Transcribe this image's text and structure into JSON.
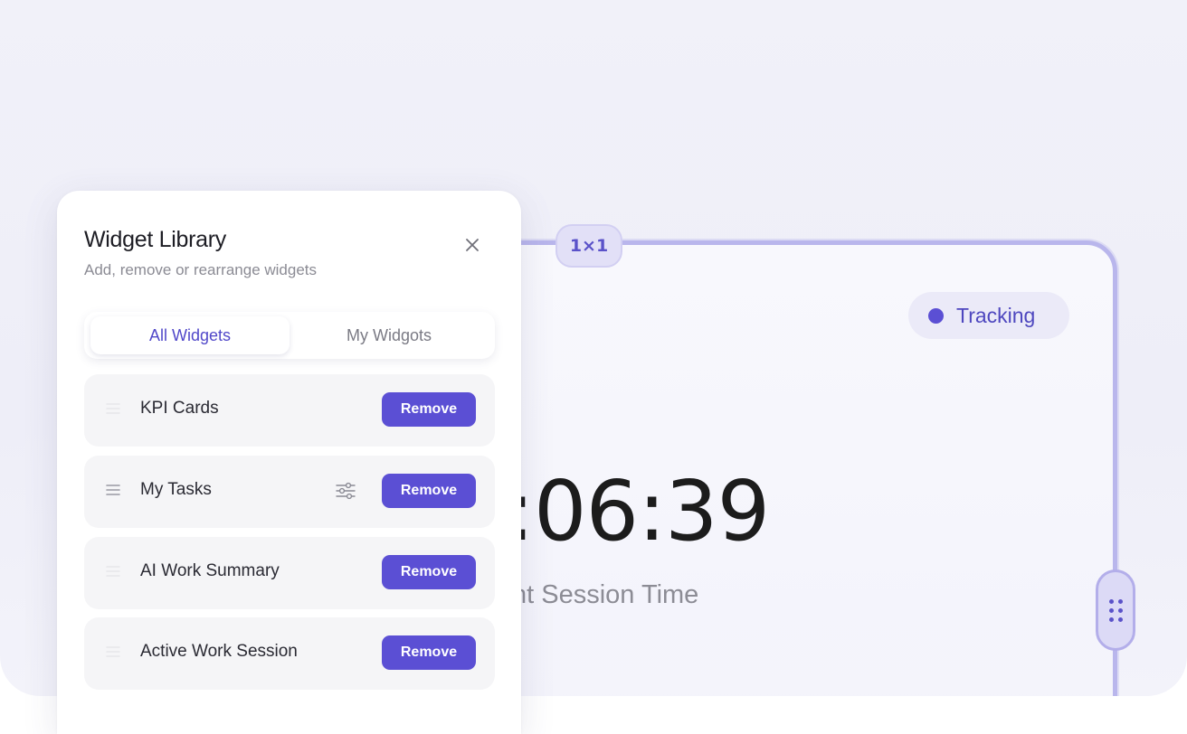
{
  "widget": {
    "size_badge": "1×1",
    "status": "Tracking",
    "timer": ":06:39",
    "timer_label": "nt Session Time"
  },
  "panel": {
    "title": "Widget Library",
    "subtitle": "Add, remove or rearrange widgets",
    "tabs": [
      {
        "label": "All Widgets",
        "active": true
      },
      {
        "label": "My Widgots",
        "active": false
      }
    ],
    "items": [
      {
        "label": "KPI Cards",
        "action": "Remove",
        "has_config": false
      },
      {
        "label": "My Tasks",
        "action": "Remove",
        "has_config": true
      },
      {
        "label": "AI Work Summary",
        "action": "Remove",
        "has_config": false
      },
      {
        "label": "Active Work Session",
        "action": "Remove",
        "has_config": false
      }
    ]
  },
  "colors": {
    "accent": "#5b4fd4",
    "widget_border": "#b9b6ec",
    "background": "#efeff8"
  },
  "icons": [
    "close-icon",
    "drag-handle-icon",
    "sliders-icon",
    "grip-dots-icon",
    "status-dot-icon"
  ]
}
